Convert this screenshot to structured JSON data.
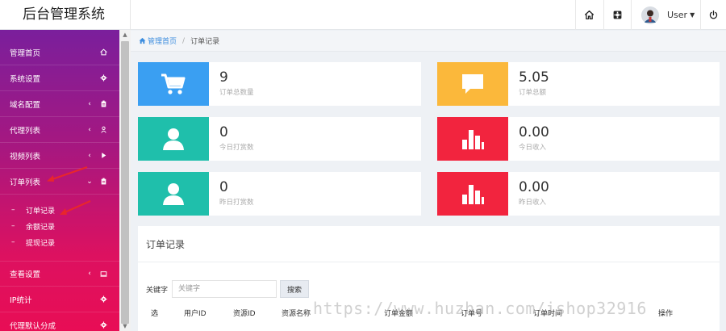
{
  "header": {
    "brand": "后台管理系统",
    "user_name": "User",
    "icons": [
      "home-icon",
      "settings-icon",
      "power-icon"
    ]
  },
  "sidebar": {
    "items": [
      {
        "label": "管理首页",
        "chevron": "",
        "icon": "home-icon"
      },
      {
        "label": "系统设置",
        "chevron": "",
        "icon": "gear-icon"
      },
      {
        "label": "域名配置",
        "chevron": "‹",
        "icon": "clipboard-icon"
      },
      {
        "label": "代理列表",
        "chevron": "‹",
        "icon": "user-icon"
      },
      {
        "label": "视频列表",
        "chevron": "‹",
        "icon": "play-icon"
      },
      {
        "label": "订单列表",
        "chevron": "⌄",
        "icon": "clipboard-icon"
      }
    ],
    "sub_items": [
      {
        "dash": "–",
        "label": "订单记录"
      },
      {
        "dash": "–",
        "label": "余额记录"
      },
      {
        "dash": "–",
        "label": "提现记录"
      }
    ],
    "lower_items": [
      {
        "label": "查看设置",
        "chevron": "‹",
        "icon": "monitor-icon"
      },
      {
        "label": "IP统计",
        "chevron": "",
        "icon": "gear-icon"
      },
      {
        "label": "代理默认分成",
        "chevron": "",
        "icon": "gear-icon"
      }
    ],
    "scroll_up": "▲",
    "scroll_down": "▼"
  },
  "breadcrumb": {
    "home": "管理首页",
    "sep": "/",
    "current": "订单记录"
  },
  "cards": [
    {
      "value": "9",
      "label": "订单总数量",
      "color": "#3a9ff2",
      "icon": "cart-icon"
    },
    {
      "value": "5.05",
      "label": "订单总额",
      "color": "#fbb83b",
      "icon": "comment-icon"
    },
    {
      "value": "0",
      "label": "今日打赏数",
      "color": "#1fbfab",
      "icon": "user-icon"
    },
    {
      "value": "0.00",
      "label": "今日收入",
      "color": "#f2243e",
      "icon": "bar-chart-icon"
    },
    {
      "value": "0",
      "label": "昨日打赏数",
      "color": "#1fbfab",
      "icon": "user-icon"
    },
    {
      "value": "0.00",
      "label": "昨日收入",
      "color": "#f2243e",
      "icon": "bar-chart-icon"
    }
  ],
  "panel": {
    "title": "订单记录",
    "search_label": "关键字",
    "search_placeholder": "关键字",
    "search_button": "搜索",
    "columns": [
      "选",
      "用户ID",
      "资源ID",
      "资源名称",
      "订单金额",
      "订单号",
      "订单时间",
      "操作"
    ]
  },
  "watermark": "https://www.huzhan.com/ishop32916"
}
